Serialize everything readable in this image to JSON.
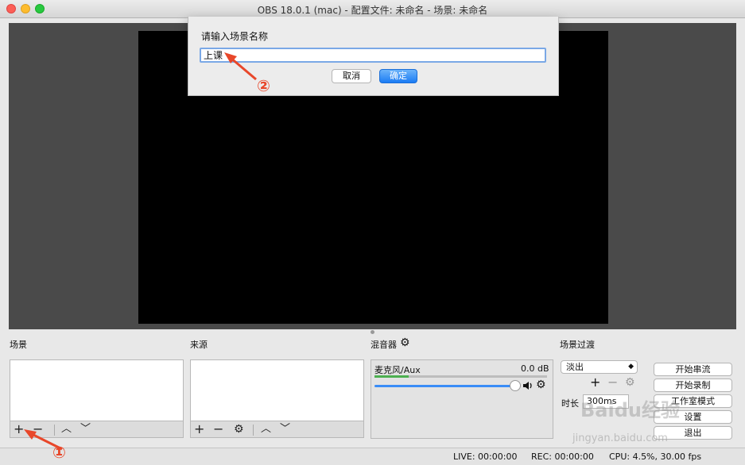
{
  "window": {
    "title": "OBS 18.0.1 (mac) - 配置文件: 未命名 - 场景: 未命名"
  },
  "dialog": {
    "label": "请输入场景名称",
    "input_value": "上课",
    "cancel_label": "取消",
    "ok_label": "确定"
  },
  "docks": {
    "scenes_label": "场景",
    "sources_label": "来源",
    "mixer_label": "混音器",
    "transitions_label": "场景过渡"
  },
  "toolbar": {
    "add": "+",
    "remove": "−",
    "up": "︿",
    "down": "﹀",
    "gear": "⚙"
  },
  "mixer": {
    "source_name": "麦克风/Aux",
    "db_value": "0.0 dB",
    "level": 0.2,
    "volume": 0.95
  },
  "transitions": {
    "selected": "淡出",
    "duration_label": "时长",
    "duration_value": "300ms"
  },
  "controls": {
    "start_stream": "开始串流",
    "start_record": "开始录制",
    "studio_mode": "工作室模式",
    "settings": "设置",
    "exit": "退出"
  },
  "status": {
    "live": "LIVE: 00:00:00",
    "rec": "REC: 00:00:00",
    "cpu": "CPU: 4.5%, 30.00 fps"
  },
  "annotations": {
    "marker_1": "①",
    "marker_2": "②"
  },
  "watermark": {
    "logo": "Baidu经验",
    "url": "jingyan.baidu.com"
  },
  "colors": {
    "accent": "#1c7cf4",
    "annotation": "#e8472a",
    "canvas": "#000000"
  },
  "icons": {
    "close": "close-icon",
    "minimize": "minimize-icon",
    "maximize": "maximize-icon",
    "gear": "gear-icon",
    "speaker": "speaker-icon"
  }
}
